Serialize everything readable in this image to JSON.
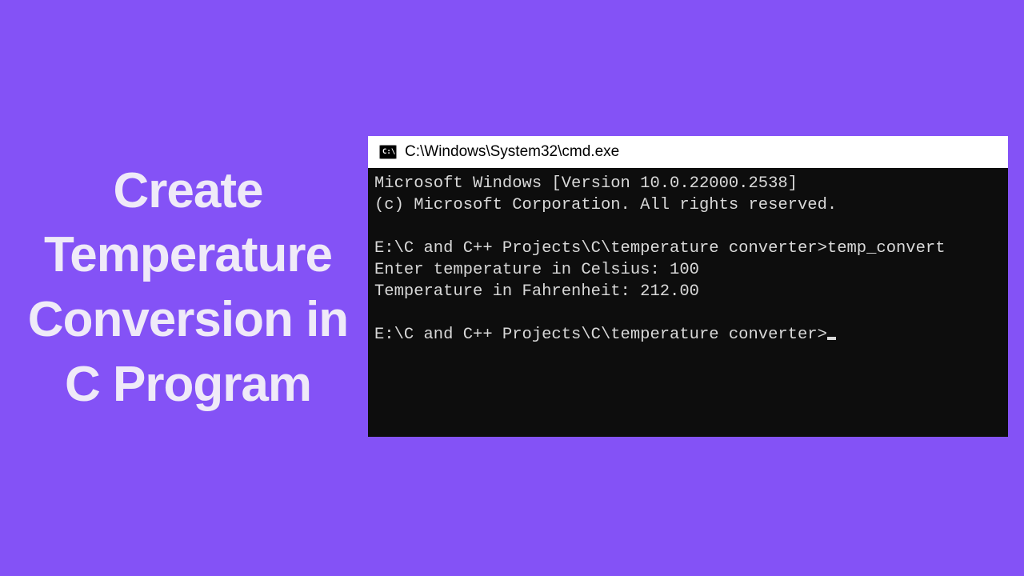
{
  "heading": "Create Temperature Conversion in C Program",
  "titlebar": {
    "icon_label": "C:\\.",
    "path": "C:\\Windows\\System32\\cmd.exe"
  },
  "terminal": {
    "line1": "Microsoft Windows [Version 10.0.22000.2538]",
    "line2": "(c) Microsoft Corporation. All rights reserved.",
    "blank1": "",
    "line3": "E:\\C and C++ Projects\\C\\temperature converter>temp_convert",
    "line4": "Enter temperature in Celsius: 100",
    "line5": "Temperature in Fahrenheit: 212.00",
    "blank2": "",
    "line6": "E:\\C and C++ Projects\\C\\temperature converter>"
  }
}
